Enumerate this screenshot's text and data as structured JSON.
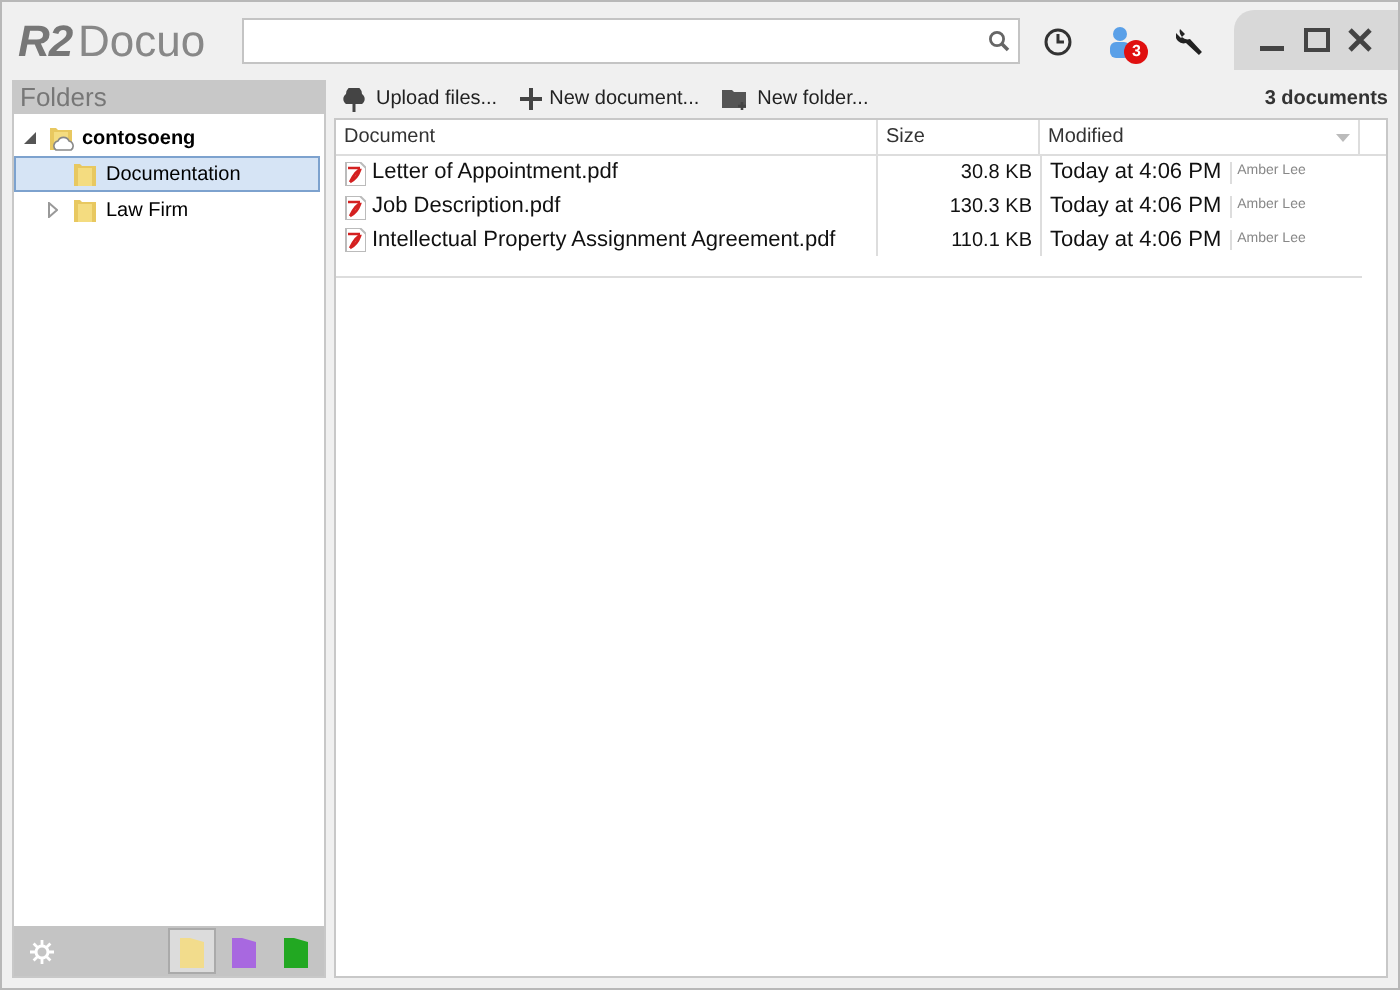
{
  "logo": {
    "mark": "R2",
    "name": "Docuo"
  },
  "notifications": {
    "count": "3"
  },
  "sidebar": {
    "title": "Folders",
    "tree": [
      {
        "label": "contosoeng",
        "kind": "cloud",
        "expanded": true,
        "selected": false,
        "children": [
          {
            "label": "Documentation",
            "kind": "folder",
            "selected": true
          },
          {
            "label": "Law Firm",
            "kind": "folder",
            "expanded": false,
            "selected": false
          }
        ]
      }
    ],
    "folder_colors": [
      {
        "color": "#f2dc8c",
        "selected": true
      },
      {
        "color": "#a868e0",
        "selected": false
      },
      {
        "color": "#22a822",
        "selected": false
      }
    ]
  },
  "toolbar": {
    "actions": [
      {
        "label": "Upload files...",
        "kind": "upload"
      },
      {
        "label": "New document...",
        "kind": "plus"
      },
      {
        "label": "New folder...",
        "kind": "folder"
      }
    ],
    "count": "3 documents"
  },
  "table": {
    "columns": [
      "Document",
      "Size",
      "Modified"
    ],
    "rows": [
      {
        "name": "Letter of Appointment.pdf",
        "size": "30.8 KB",
        "modified": "Today at 4:06 PM",
        "user": "Amber Lee"
      },
      {
        "name": "Job Description.pdf",
        "size": "130.3 KB",
        "modified": "Today at 4:06 PM",
        "user": "Amber Lee"
      },
      {
        "name": "Intellectual Property Assignment Agreement.pdf",
        "size": "110.1 KB",
        "modified": "Today at 4:06 PM",
        "user": "Amber Lee"
      }
    ]
  }
}
